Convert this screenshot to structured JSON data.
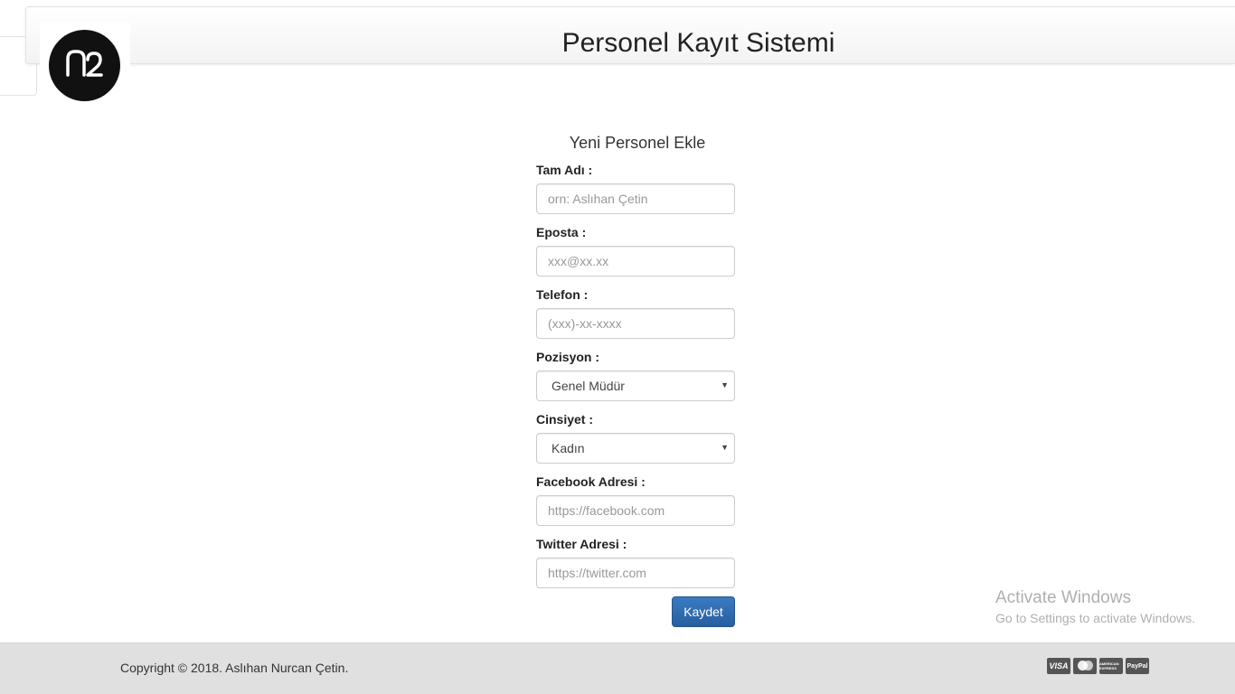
{
  "header": {
    "title": "Personel Kayıt Sistemi"
  },
  "form": {
    "title": "Yeni Personel Ekle",
    "fields": [
      {
        "label": "Tam Adı :",
        "placeholder": "orn: Aslıhan Çetin"
      },
      {
        "label": "Eposta :",
        "placeholder": "xxx@xx.xx"
      },
      {
        "label": "Telefon :",
        "placeholder": "(xxx)-xx-xxxx"
      },
      {
        "label": "Pozisyon :",
        "selected": "Genel Müdür"
      },
      {
        "label": "Cinsiyet :",
        "selected": "Kadın"
      },
      {
        "label": "Facebook Adresi :",
        "placeholder": "https://facebook.com"
      },
      {
        "label": "Twitter Adresi :",
        "placeholder": "https://twitter.com"
      }
    ],
    "submit_label": "Kaydet"
  },
  "watermark": {
    "title": "Activate Windows",
    "subtitle": "Go to Settings to activate Windows."
  },
  "footer": {
    "copyright": "Copyright © 2018. Aslıhan Nurcan Çetin.",
    "payment_icons": [
      "visa-icon",
      "mastercard-icon",
      "amex-icon",
      "paypal-icon"
    ],
    "payment_labels": [
      "VISA",
      "",
      "AMERICAN EXPRESS",
      "PayPal"
    ]
  },
  "colors": {
    "primary_button": "#2f6aac",
    "footer_bg": "#e0e0e0",
    "logo_bg": "#111111"
  }
}
